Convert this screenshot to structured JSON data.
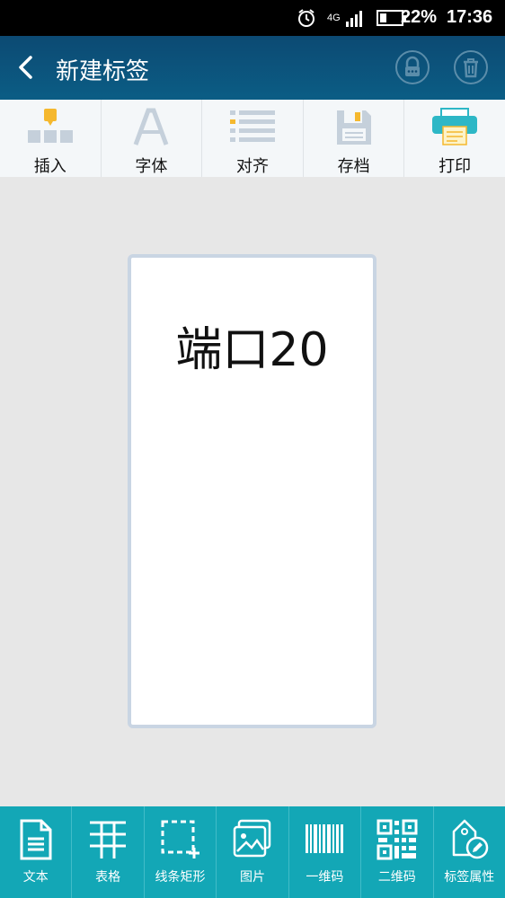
{
  "status_bar": {
    "network": "4G",
    "battery_percent": "22%",
    "time": "17:36",
    "icons": [
      "alarm-icon",
      "signal-icon",
      "battery-icon"
    ]
  },
  "header": {
    "title": "新建标签",
    "actions": [
      "back-icon",
      "lock-icon",
      "trash-icon"
    ],
    "background": "#0c4a73"
  },
  "toolbar": {
    "items": [
      {
        "label": "插入",
        "icon": "insert-icon"
      },
      {
        "label": "字体",
        "icon": "font-icon"
      },
      {
        "label": "对齐",
        "icon": "align-icon"
      },
      {
        "label": "存档",
        "icon": "save-icon"
      },
      {
        "label": "打印",
        "icon": "print-icon"
      }
    ]
  },
  "label_canvas": {
    "text": "端口20"
  },
  "bottom_bar": {
    "background": "#13a7b6",
    "items": [
      {
        "label": "文本",
        "icon": "text-doc-icon"
      },
      {
        "label": "表格",
        "icon": "table-icon"
      },
      {
        "label": "线条矩形",
        "icon": "rectangle-icon"
      },
      {
        "label": "图片",
        "icon": "image-icon"
      },
      {
        "label": "一维码",
        "icon": "barcode-icon"
      },
      {
        "label": "二维码",
        "icon": "qrcode-icon"
      },
      {
        "label": "标签属性",
        "icon": "tag-settings-icon"
      }
    ]
  }
}
